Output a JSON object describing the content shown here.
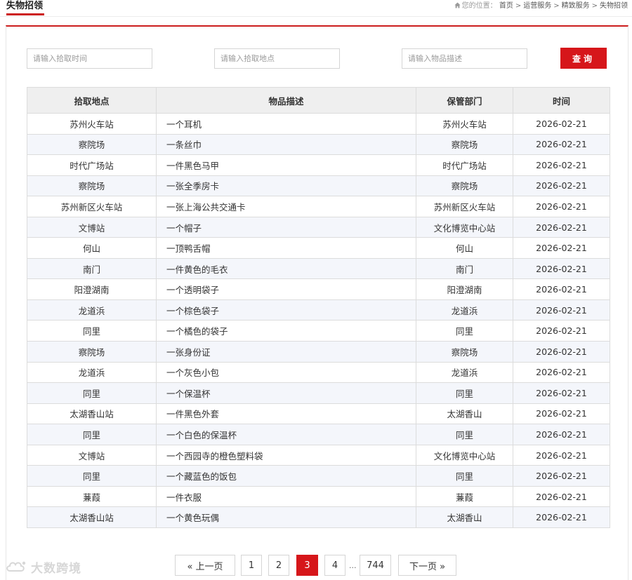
{
  "header": {
    "title": "失物招领",
    "breadcrumb": {
      "location_label": "您的位置：",
      "items": [
        "首页",
        "运营服务",
        "精致服务",
        "失物招领"
      ],
      "separator": ">"
    }
  },
  "search": {
    "time_placeholder": "请输入拾取时间",
    "place_placeholder": "请输入拾取地点",
    "desc_placeholder": "请输入物品描述",
    "query_label": "查询"
  },
  "table": {
    "headers": [
      "拾取地点",
      "物品描述",
      "保管部门",
      "时间"
    ],
    "rows": [
      [
        "苏州火车站",
        "一个耳机",
        "苏州火车站",
        "2026-02-21"
      ],
      [
        "察院场",
        "一条丝巾",
        "察院场",
        "2026-02-21"
      ],
      [
        "时代广场站",
        "一件黑色马甲",
        "时代广场站",
        "2026-02-21"
      ],
      [
        "察院场",
        "一张全季房卡",
        "察院场",
        "2026-02-21"
      ],
      [
        "苏州新区火车站",
        "一张上海公共交通卡",
        "苏州新区火车站",
        "2026-02-21"
      ],
      [
        "文博站",
        "一个帽子",
        "文化博览中心站",
        "2026-02-21"
      ],
      [
        "何山",
        "一顶鸭舌帽",
        "何山",
        "2026-02-21"
      ],
      [
        "南门",
        "一件黄色的毛衣",
        "南门",
        "2026-02-21"
      ],
      [
        "阳澄湖南",
        "一个透明袋子",
        "阳澄湖南",
        "2026-02-21"
      ],
      [
        "龙道浜",
        "一个棕色袋子",
        "龙道浜",
        "2026-02-21"
      ],
      [
        "同里",
        "一个橘色的袋子",
        "同里",
        "2026-02-21"
      ],
      [
        "察院场",
        "一张身份证",
        "察院场",
        "2026-02-21"
      ],
      [
        "龙道浜",
        "一个灰色小包",
        "龙道浜",
        "2026-02-21"
      ],
      [
        "同里",
        "一个保温杯",
        "同里",
        "2026-02-21"
      ],
      [
        "太湖香山站",
        "一件黑色外套",
        "太湖香山",
        "2026-02-21"
      ],
      [
        "同里",
        "一个白色的保温杯",
        "同里",
        "2026-02-21"
      ],
      [
        "文博站",
        "一个西园寺的橙色塑料袋",
        "文化博览中心站",
        "2026-02-21"
      ],
      [
        "同里",
        "一个藏蓝色的饭包",
        "同里",
        "2026-02-21"
      ],
      [
        "蒹葭",
        "一件衣服",
        "蒹葭",
        "2026-02-21"
      ],
      [
        "太湖香山站",
        "一个黄色玩偶",
        "太湖香山",
        "2026-02-21"
      ]
    ]
  },
  "pagination": {
    "prev_label": "« 上一页",
    "pages": [
      "1",
      "2",
      "3",
      "4"
    ],
    "ellipsis": "...",
    "last_page": "744",
    "next_label": "下一页 »",
    "current_page": "3"
  },
  "watermark": {
    "text": "大数跨境"
  },
  "colors": {
    "accent": "#d6161a",
    "header_bg": "#efefef",
    "stripe_bg": "#f4f6fb"
  },
  "icons": {
    "breadcrumb_home": "home-icon",
    "watermark_logo": "cloud-logo-icon"
  }
}
